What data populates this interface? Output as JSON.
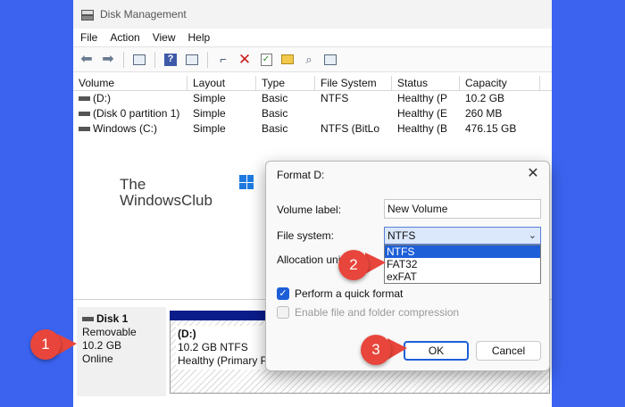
{
  "window": {
    "title": "Disk Management",
    "menu": [
      "File",
      "Action",
      "View",
      "Help"
    ]
  },
  "grid": {
    "columns": [
      "Volume",
      "Layout",
      "Type",
      "File System",
      "Status",
      "Capacity"
    ],
    "rows": [
      [
        "(D:)",
        "Simple",
        "Basic",
        "NTFS",
        "Healthy (P",
        "10.2  GB"
      ],
      [
        "(Disk 0 partition 1)",
        "Simple",
        "Basic",
        "",
        "Healthy (E",
        "260 MB"
      ],
      [
        "Windows (C:)",
        "Simple",
        "Basic",
        "NTFS (BitLo",
        "Healthy (B",
        "476.15 GB"
      ]
    ]
  },
  "watermark": {
    "line1": "The",
    "line2": "WindowsClub"
  },
  "disk": {
    "name": "Disk 1",
    "kind": "Removable",
    "size": "10.2 GB",
    "state": "Online",
    "partition_name": "(D:)",
    "partition_size": "10.2 GB NTFS",
    "partition_status": "Healthy (Primary Pa"
  },
  "dialog": {
    "title": "Format D:",
    "volume_label_text": "Volume label:",
    "volume_label_value": "New Volume",
    "file_system_text": "File system:",
    "file_system_value": "NTFS",
    "options": [
      "NTFS",
      "FAT32",
      "exFAT"
    ],
    "allocation_text": "Allocation unit",
    "quick_format": "Perform a quick format",
    "compression": "Enable file and folder compression",
    "ok": "OK",
    "cancel": "Cancel"
  },
  "badges": [
    "1",
    "2",
    "3"
  ],
  "colors": {
    "background": "#3b63f0",
    "accent": "#1e5fd8",
    "badge": "#e8463c",
    "partition_bar": "#0a1d8a"
  }
}
